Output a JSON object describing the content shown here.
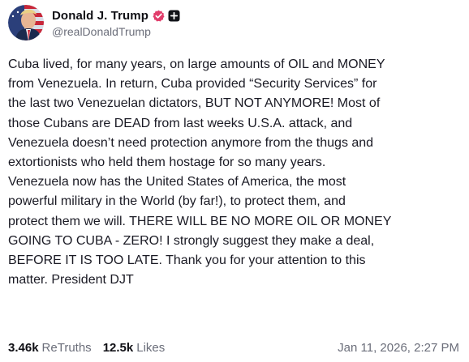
{
  "post": {
    "author": {
      "display_name": "Donald J. Trump",
      "handle": "@realDonaldTrump",
      "avatar_icon": "profile-photo",
      "verified_icon": "verified-badge-icon",
      "plus_icon": "plus-badge-icon"
    },
    "body": "Cuba lived, for many years, on large amounts of OIL and MONEY\nfrom Venezuela. In return, Cuba provided “Security Services” for\nthe last two Venezuelan dictators, BUT NOT ANYMORE! Most of\nthose Cubans are DEAD from last weeks U.S.A. attack, and\nVenezuela doesn’t need protection anymore from the thugs and\nextortionists who held them hostage for so many years.\nVenezuela now has the United States of America, the most\npowerful military in the World (by far!), to protect them, and\nprotect them we will. THERE WILL BE NO MORE OIL OR MONEY\nGOING TO CUBA - ZERO! I strongly suggest they make a deal,\nBEFORE IT IS TOO LATE. Thank you for your attention to this\nmatter. President DJT",
    "stats": {
      "retruths_count": "3.46k",
      "retruths_label": "ReTruths",
      "likes_count": "12.5k",
      "likes_label": "Likes"
    },
    "timestamp": "Jan 11, 2026, 2:27 PM"
  },
  "colors": {
    "verified": "#e13d6b",
    "text_primary": "#0f0f14",
    "text_secondary": "#6b6e7a"
  }
}
